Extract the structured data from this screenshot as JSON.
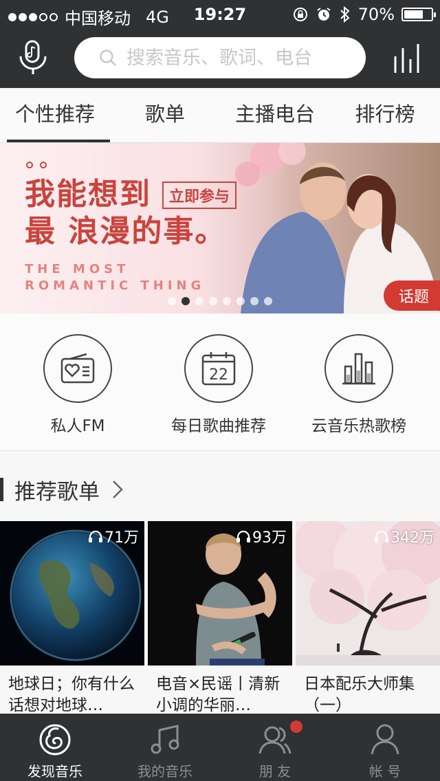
{
  "status_bar": {
    "carrier": "中国移动",
    "network": "4G",
    "time": "19:27",
    "battery": "70%",
    "battery_level": 0.7,
    "signal_dots_filled": 3,
    "signal_dots_total": 5
  },
  "header": {
    "search_placeholder": "搜索音乐、歌词、电台",
    "mic_icon": "microphone-icon",
    "eq_icon": "equalizer-icon"
  },
  "tabs": [
    {
      "label": "个性推荐",
      "active": true
    },
    {
      "label": "歌单",
      "active": false
    },
    {
      "label": "主播电台",
      "active": false
    },
    {
      "label": "排行榜",
      "active": false
    }
  ],
  "banner": {
    "title_line1": "我能想到",
    "title_line2": "最 浪漫的事。",
    "button": "立即参与",
    "en_line1": "THE MOST",
    "en_line2": "ROMANTIC THING",
    "tag": "话题",
    "page_count": 8,
    "current_page": 2
  },
  "quick_entries": [
    {
      "label": "私人FM",
      "icon": "radio-heart-icon"
    },
    {
      "label": "每日歌曲推荐",
      "icon": "calendar-icon",
      "day": "22"
    },
    {
      "label": "云音乐热歌榜",
      "icon": "bar-chart-icon"
    }
  ],
  "section": {
    "title": "推荐歌单"
  },
  "playlists": [
    {
      "plays": "71万",
      "title": "地球日；你有什么话想对地球…",
      "cover": "earth"
    },
    {
      "plays": "93万",
      "title": "电音×民谣丨清新小调的华丽…",
      "cover": "concert"
    },
    {
      "plays": "342万",
      "title": "日本配乐大师集（一）",
      "cover": "blossom"
    }
  ],
  "bottom_nav": [
    {
      "label": "发现音乐",
      "icon": "netease-logo-icon",
      "active": true
    },
    {
      "label": "我的音乐",
      "icon": "music-note-icon",
      "active": false
    },
    {
      "label": "朋 友",
      "icon": "friends-icon",
      "active": false,
      "badge": true
    },
    {
      "label": "帐 号",
      "icon": "person-icon",
      "active": false
    }
  ],
  "colors": {
    "header_bg": "#2f3133",
    "accent_red": "#d33a31",
    "banner_text": "#c9443d"
  }
}
